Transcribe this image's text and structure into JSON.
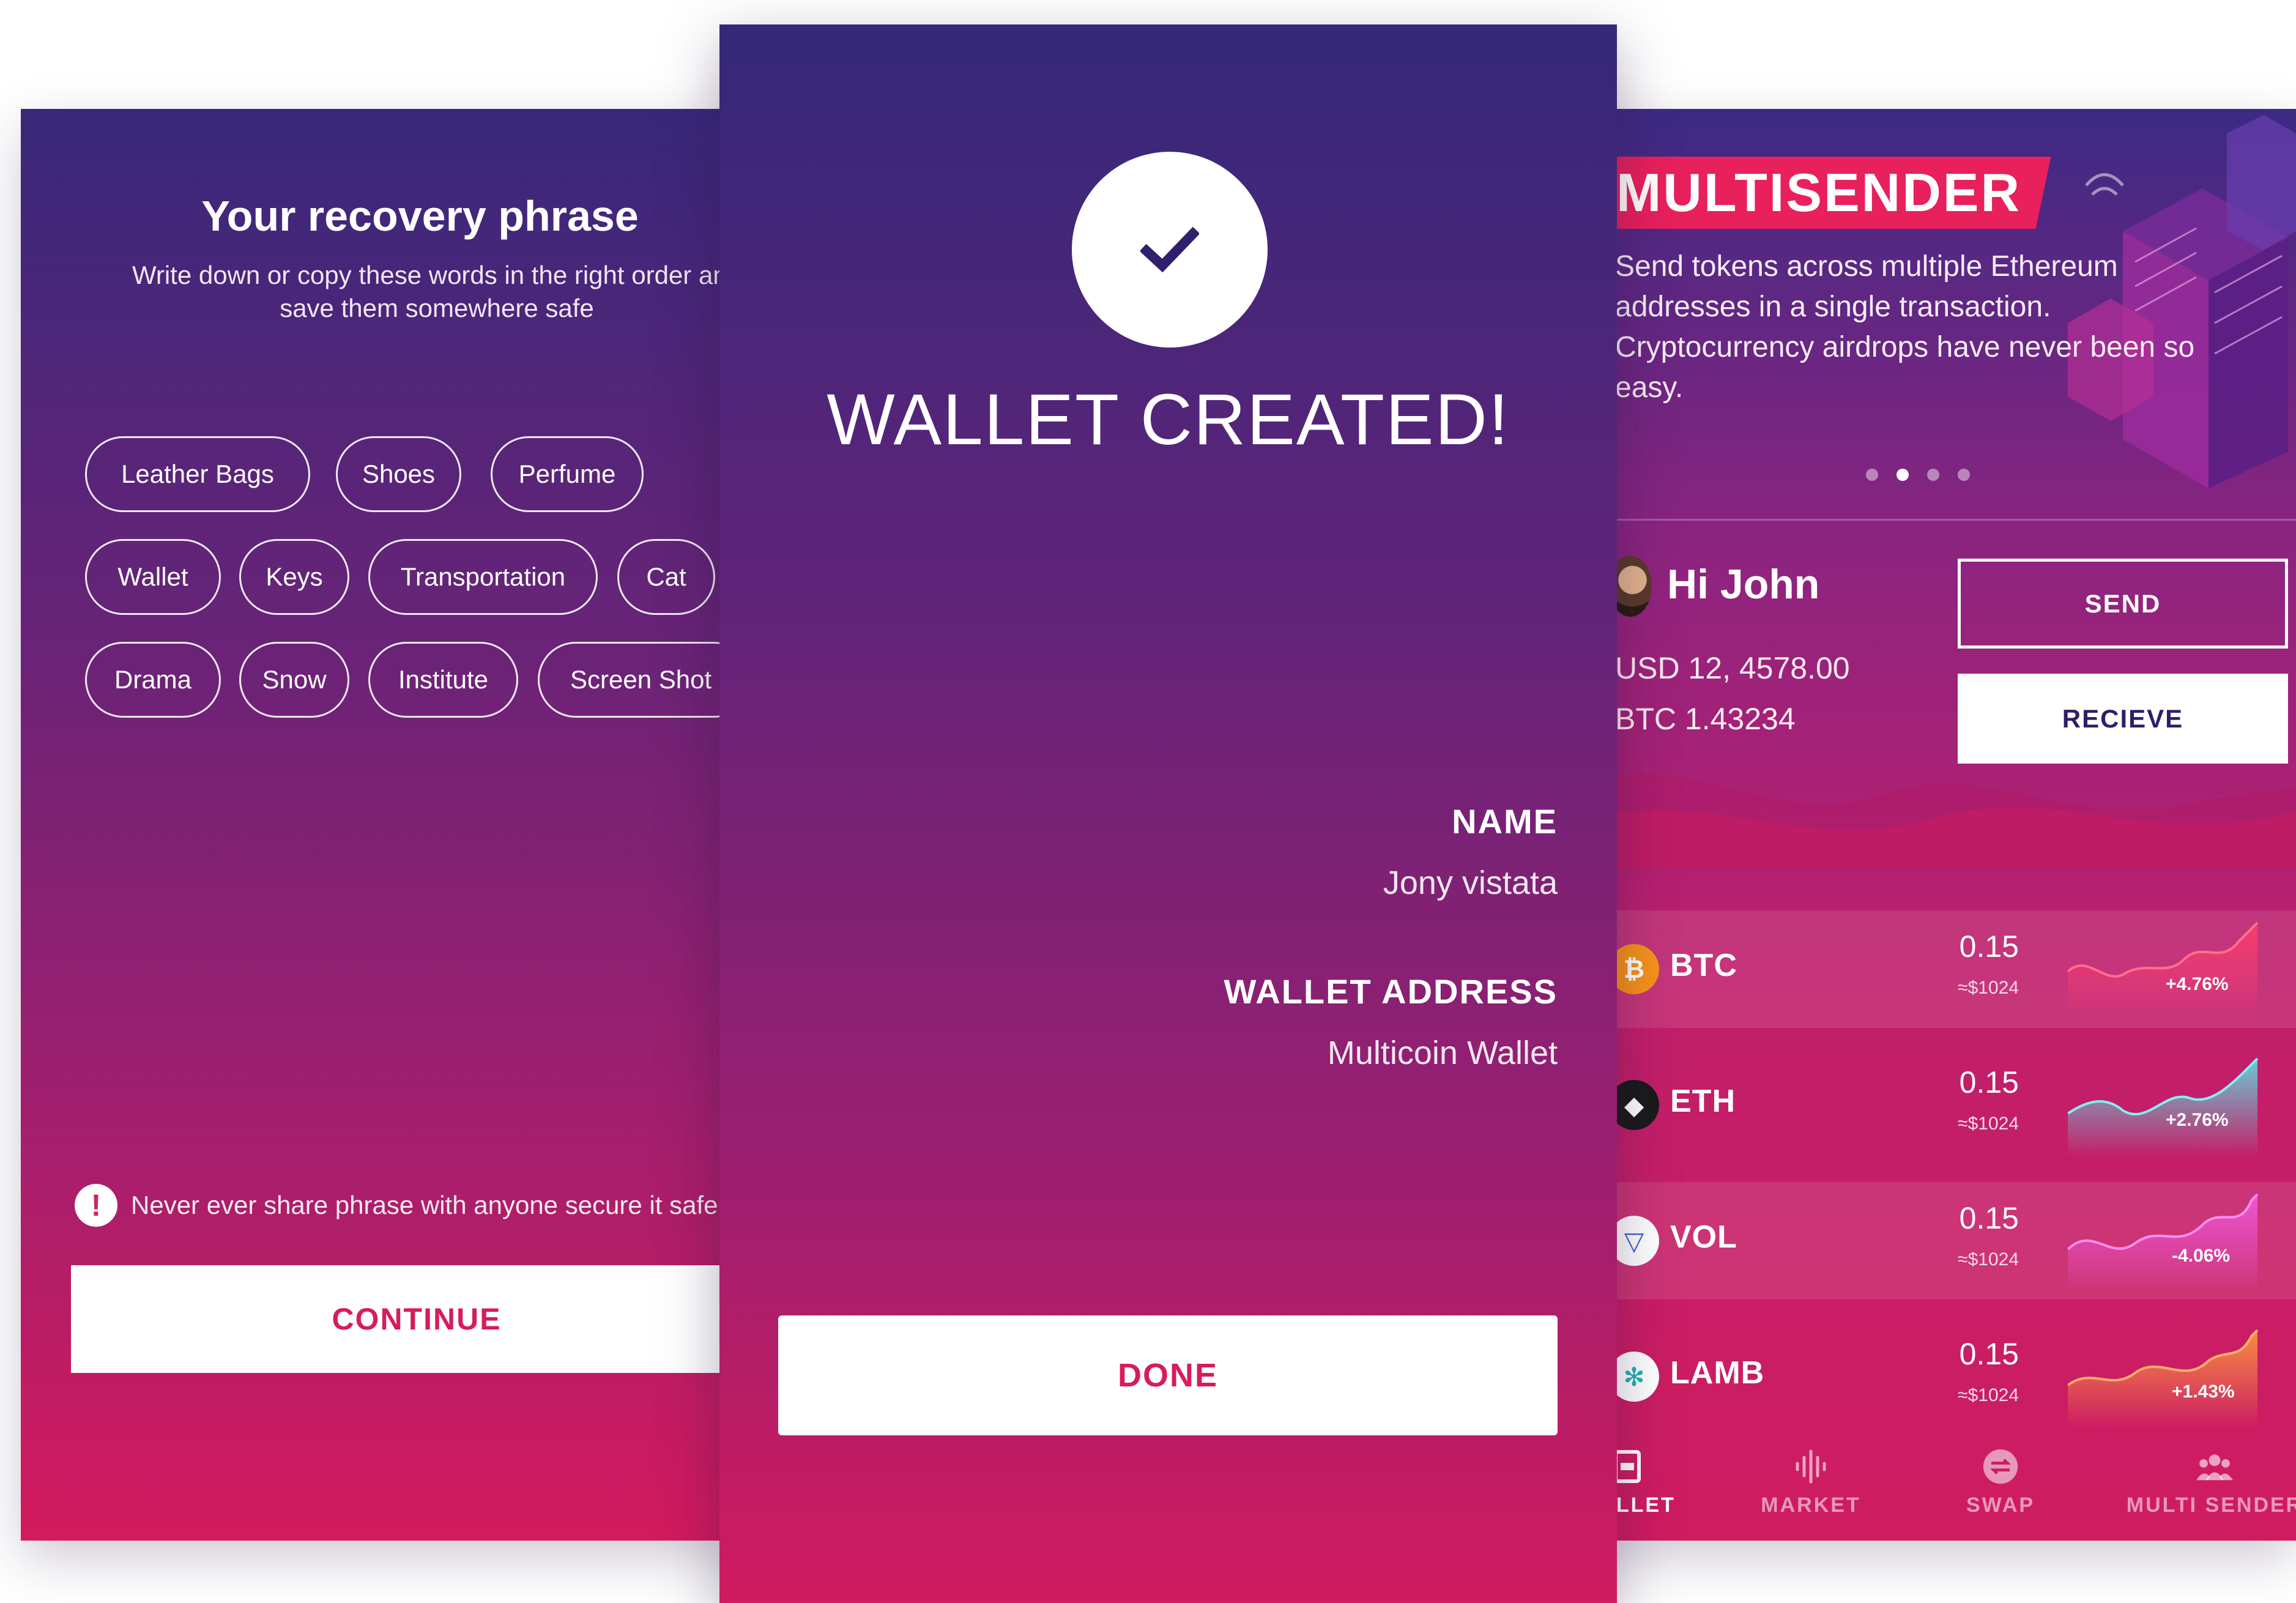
{
  "recovery": {
    "title": "Your recovery phrase",
    "subtitle_line1": "Write down or copy these words in the right order and",
    "subtitle_line2": "save them somewhere safe",
    "words": [
      "Leather Bags",
      "Shoes",
      "Perfume",
      "Wallet",
      "Keys",
      "Transportation",
      "Cat",
      "Drama",
      "Snow",
      "Institute",
      "Screen Shot"
    ],
    "warning": "Never ever share phrase with anyone secure it safely",
    "continue_label": "CONTINUE"
  },
  "created": {
    "title": "WALLET CREATED!",
    "name_label": "NAME",
    "name_value": "Jony vistata",
    "address_label": "WALLET ADDRESS",
    "address_value": "Multicoin Wallet",
    "done_label": "DONE"
  },
  "dashboard": {
    "banner_title": "MULTISENDER",
    "banner_line1": "Send tokens across multiple Ethereum",
    "banner_line2": "addresses in a single transaction.",
    "banner_line3": "Cryptocurrency airdrops have never been so",
    "banner_line4": "easy.",
    "greeting": "Hi John",
    "balance_usd": "USD 12, 4578.00",
    "balance_btc": "BTC 1.43234",
    "send_label": "SEND",
    "receive_label": "RECIEVE",
    "coins": [
      {
        "symbol": "BTC",
        "amount": "0.15",
        "usd": "≈$1024",
        "change": "+4.76%"
      },
      {
        "symbol": "ETH",
        "amount": "0.15",
        "usd": "≈$1024",
        "change": "+2.76%"
      },
      {
        "symbol": "VOL",
        "amount": "0.15",
        "usd": "≈$1024",
        "change": "-4.06%"
      },
      {
        "symbol": "LAMB",
        "amount": "0.15",
        "usd": "≈$1024",
        "change": "+1.43%"
      }
    ],
    "nav": [
      {
        "label": "WALLET",
        "icon": "wallet-icon"
      },
      {
        "label": "MARKET",
        "icon": "market-icon"
      },
      {
        "label": "SWAP",
        "icon": "swap-icon"
      },
      {
        "label": "MULTI SENDER",
        "icon": "multi-sender-icon"
      }
    ]
  },
  "colors": {
    "accent": "#d81b5e",
    "deep_purple": "#342879",
    "btc": "#f7931a",
    "eth": "#1a1a1a",
    "vol": "#ffffff",
    "lamb": "#ffffff"
  }
}
